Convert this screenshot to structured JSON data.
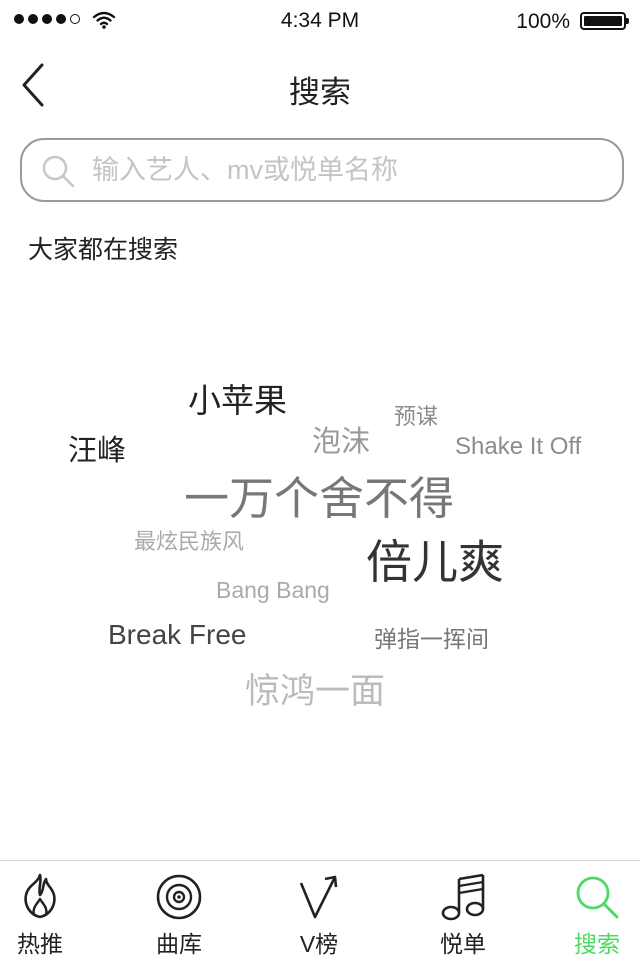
{
  "status_bar": {
    "time": "4:34 PM",
    "battery": "100%",
    "signal_icon": "signal-dots-icon",
    "wifi_icon": "wifi-icon",
    "battery_icon": "battery-icon"
  },
  "nav": {
    "title": "搜索",
    "back_icon": "chevron-left-icon"
  },
  "search": {
    "placeholder": "输入艺人、mv或悦单名称",
    "value": "",
    "icon": "search-icon"
  },
  "section_title": "大家都在搜索",
  "tags": [
    {
      "label": "小苹果",
      "color": "#222222"
    },
    {
      "label": "预谋",
      "color": "#8c8c8c"
    },
    {
      "label": "汪峰",
      "color": "#222222"
    },
    {
      "label": "泡沫",
      "color": "#9a9a9a"
    },
    {
      "label": "Shake It Off",
      "color": "#8c8c8c"
    },
    {
      "label": "一万个舍不得",
      "color": "#777777"
    },
    {
      "label": "最炫民族风",
      "color": "#aaaaaa"
    },
    {
      "label": "倍儿爽",
      "color": "#333333"
    },
    {
      "label": "Bang Bang",
      "color": "#aaaaaa"
    },
    {
      "label": "Break Free",
      "color": "#444444"
    },
    {
      "label": "弹指一挥间",
      "color": "#777777"
    },
    {
      "label": "惊鸿一面",
      "color": "#bbbbbb"
    }
  ],
  "tabbar": {
    "active_color": "#4cd964",
    "tabs": [
      {
        "label": "热推",
        "icon": "flame-icon",
        "active": false
      },
      {
        "label": "曲库",
        "icon": "vinyl-record-icon",
        "active": false
      },
      {
        "label": "V榜",
        "icon": "v-chart-icon",
        "active": false
      },
      {
        "label": "悦单",
        "icon": "music-note-icon",
        "active": false
      },
      {
        "label": "搜索",
        "icon": "search-icon",
        "active": true
      }
    ]
  }
}
